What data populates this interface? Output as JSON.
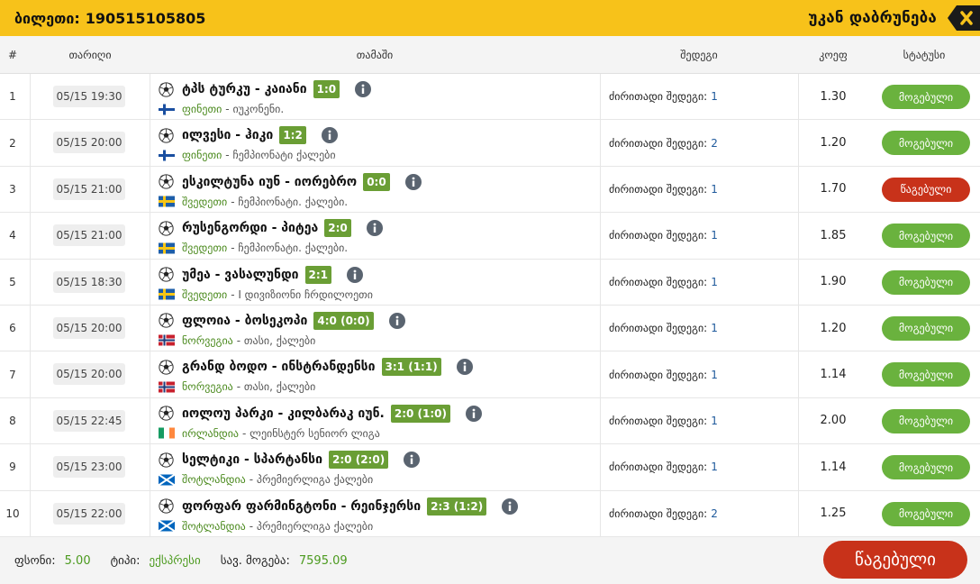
{
  "header": {
    "ticket_label": "ბილეთი:",
    "ticket_number": "190515105805",
    "back_label": "უკან დაბრუნება"
  },
  "columns": {
    "num": "#",
    "date": "თარიღი",
    "game": "თამაში",
    "result": "შედეგი",
    "odds": "კოეფ",
    "status": "სტატუსი"
  },
  "result_label": "ძირითადი შედეგი:",
  "rows": [
    {
      "num": "1",
      "date": "05/15 19:30",
      "match": "ტპს ტურკუ - კაიანი",
      "score": "1:0",
      "country": "ფინეთი",
      "league": "- იუკონენი.",
      "flag": "fi",
      "result": "1",
      "odds": "1.30",
      "status": "მოგებული",
      "status_type": "won"
    },
    {
      "num": "2",
      "date": "05/15 20:00",
      "match": "ილვესი - ჰიკი",
      "score": "1:2",
      "country": "ფინეთი",
      "league": "- ჩემპიონატი ქალები",
      "flag": "fi",
      "result": "2",
      "odds": "1.20",
      "status": "მოგებული",
      "status_type": "won"
    },
    {
      "num": "3",
      "date": "05/15 21:00",
      "match": "ესკილტუნა იუნ - იორებრო",
      "score": "0:0",
      "country": "შვედეთი",
      "league": "- ჩემპიონატი. ქალები.",
      "flag": "se",
      "result": "1",
      "odds": "1.70",
      "status": "წაგებული",
      "status_type": "lost"
    },
    {
      "num": "4",
      "date": "05/15 21:00",
      "match": "რუსენგორდი - პიტეა",
      "score": "2:0",
      "country": "შვედეთი",
      "league": "- ჩემპიონატი. ქალები.",
      "flag": "se",
      "result": "1",
      "odds": "1.85",
      "status": "მოგებული",
      "status_type": "won"
    },
    {
      "num": "5",
      "date": "05/15 18:30",
      "match": "უმეა - ვასალუნდი",
      "score": "2:1",
      "country": "შვედეთი",
      "league": "- I დივიზიონი ჩრდილოეთი",
      "flag": "se",
      "result": "1",
      "odds": "1.90",
      "status": "მოგებული",
      "status_type": "won"
    },
    {
      "num": "6",
      "date": "05/15 20:00",
      "match": "ფლოია - ბოსეკოპი",
      "score": "4:0 (0:0)",
      "country": "ნორვეგია",
      "league": "- თასი, ქალები",
      "flag": "no",
      "result": "1",
      "odds": "1.20",
      "status": "მოგებული",
      "status_type": "won"
    },
    {
      "num": "7",
      "date": "05/15 20:00",
      "match": "გრანდ ბოდო - ინსტრანდენსი",
      "score": "3:1 (1:1)",
      "country": "ნორვეგია",
      "league": "- თასი, ქალები",
      "flag": "no",
      "result": "1",
      "odds": "1.14",
      "status": "მოგებული",
      "status_type": "won"
    },
    {
      "num": "8",
      "date": "05/15 22:45",
      "match": "იოლოუ პარკი - კილბარაკ იუნ.",
      "score": "2:0 (1:0)",
      "country": "ირლანდია",
      "league": "- ლეინსტერ სენიორ ლიგა",
      "flag": "ie",
      "result": "1",
      "odds": "2.00",
      "status": "მოგებული",
      "status_type": "won"
    },
    {
      "num": "9",
      "date": "05/15 23:00",
      "match": "სელტიკი - სპარტანსი",
      "score": "2:0 (2:0)",
      "country": "შოტლანდია",
      "league": "- პრემიერლიგა ქალები",
      "flag": "sc",
      "result": "1",
      "odds": "1.14",
      "status": "მოგებული",
      "status_type": "won"
    },
    {
      "num": "10",
      "date": "05/15 22:00",
      "match": "ფორფარ ფარმინგტონი - რეინჯერსი",
      "score": "2:3 (1:2)",
      "country": "შოტლანდია",
      "league": "- პრემიერლიგა ქალები",
      "flag": "sc",
      "result": "2",
      "odds": "1.25",
      "status": "მოგებული",
      "status_type": "won"
    }
  ],
  "footer": {
    "stake_label": "ფსონი:",
    "stake_value": "5.00",
    "type_label": "ტიპი:",
    "type_value": "ექსპრესი",
    "win_label": "სავ. მოგება:",
    "win_value": "7595.09",
    "final_status": "წაგებული"
  },
  "colors": {
    "header": "#f7c21a",
    "won": "#6ab23e",
    "lost": "#c8321a",
    "score": "#6a9e35",
    "country": "#4b8a1e"
  }
}
